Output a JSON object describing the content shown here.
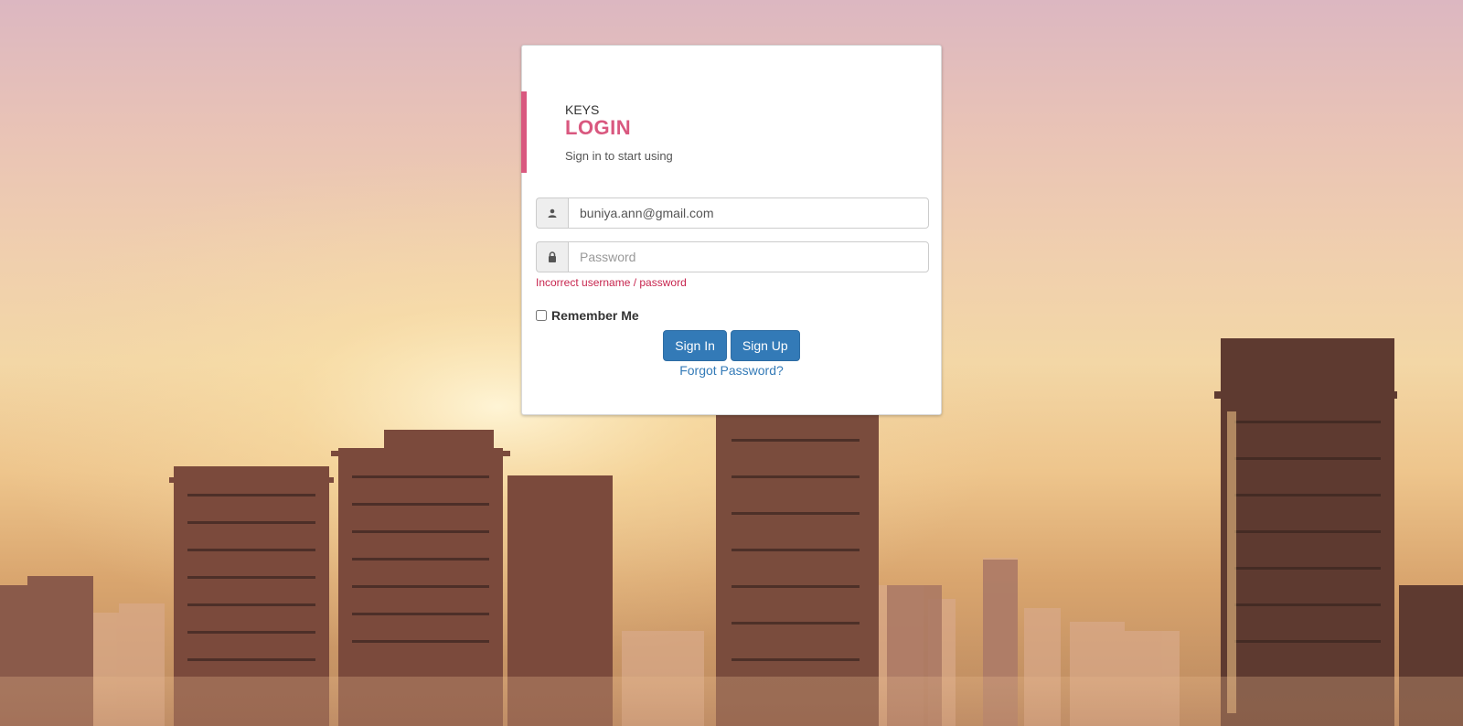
{
  "login": {
    "brand": "KEYS",
    "title": "LOGIN",
    "subtitle": "Sign in to start using",
    "email_value": "buniya.ann@gmail.com",
    "password_placeholder": "Password",
    "error": "Incorrect username / password",
    "remember_label": "Remember Me",
    "sign_in_label": "Sign In",
    "sign_up_label": "Sign Up",
    "forgot_label": "Forgot Password?"
  },
  "icons": {
    "email_addon": "user-icon",
    "password_addon": "lock-icon"
  },
  "colors": {
    "accent": "#d9587f",
    "primary": "#337ab7",
    "error": "#c7254e"
  }
}
